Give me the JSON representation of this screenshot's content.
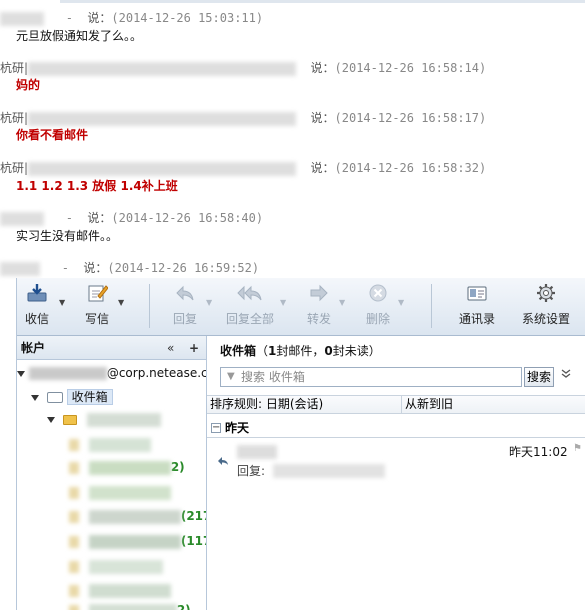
{
  "chat": {
    "say": "说：",
    "dash": "-",
    "messages": [
      {
        "sender": "",
        "time": "(2014-12-26 15:03:11)",
        "text": "元旦放假通知发了么。。",
        "emph": false
      },
      {
        "sender": "杭研|",
        "time": "(2014-12-26 16:58:14)",
        "text": "妈的",
        "emph": true
      },
      {
        "sender": "杭研|",
        "time": "(2014-12-26 16:58:17)",
        "text": "你看不看邮件",
        "emph": true
      },
      {
        "sender": "杭研|",
        "time": "(2014-12-26 16:58:32)",
        "text": "1.1 1.2 1.3 放假 1.4补上班",
        "emph": true
      },
      {
        "sender": "",
        "time": "(2014-12-26 16:58:40)",
        "text": "实习生没有邮件。。",
        "emph": false
      },
      {
        "sender": "",
        "time": "(2014-12-26 16:59:52)",
        "text": "",
        "emph": false
      }
    ]
  },
  "toolbar": {
    "receive": "收信",
    "compose": "写信",
    "reply": "回复",
    "reply_all": "回复全部",
    "forward": "转发",
    "delete": "删除",
    "contacts": "通讯录",
    "settings": "系统设置",
    "icons": {
      "receive": "inbox-download-icon",
      "compose": "compose-pencil-icon",
      "reply": "reply-arrow-icon",
      "reply_all": "reply-all-arrow-icon",
      "forward": "forward-arrow-icon",
      "delete": "delete-x-icon",
      "contacts": "address-book-icon",
      "settings": "gear-icon"
    }
  },
  "sidebar": {
    "title": "帐户",
    "collapse": "«",
    "add": "+",
    "account_suffix": "@corp.netease.c",
    "inbox": "收件箱",
    "counts": [
      "2)",
      "(217",
      "(117",
      "2)"
    ]
  },
  "pane": {
    "folder": "收件箱",
    "summary_open": "（",
    "total": "1",
    "total_unit": "封邮件，",
    "unread": "0",
    "unread_unit": "封未读）",
    "search_placeholder": "搜索 收件箱",
    "search_button": "搜索",
    "more": "»",
    "sort_label": "排序规则: 日期(会话)",
    "sort_order": "从新到旧",
    "group_toggle": "−",
    "group_label": "昨天",
    "message": {
      "time": "昨天11:02",
      "subject_prefix": "回复:"
    }
  },
  "colors": {
    "accent_red": "#c00000",
    "count_green": "#2a8a2a",
    "toolbar_bg": "#dbe5f0"
  }
}
